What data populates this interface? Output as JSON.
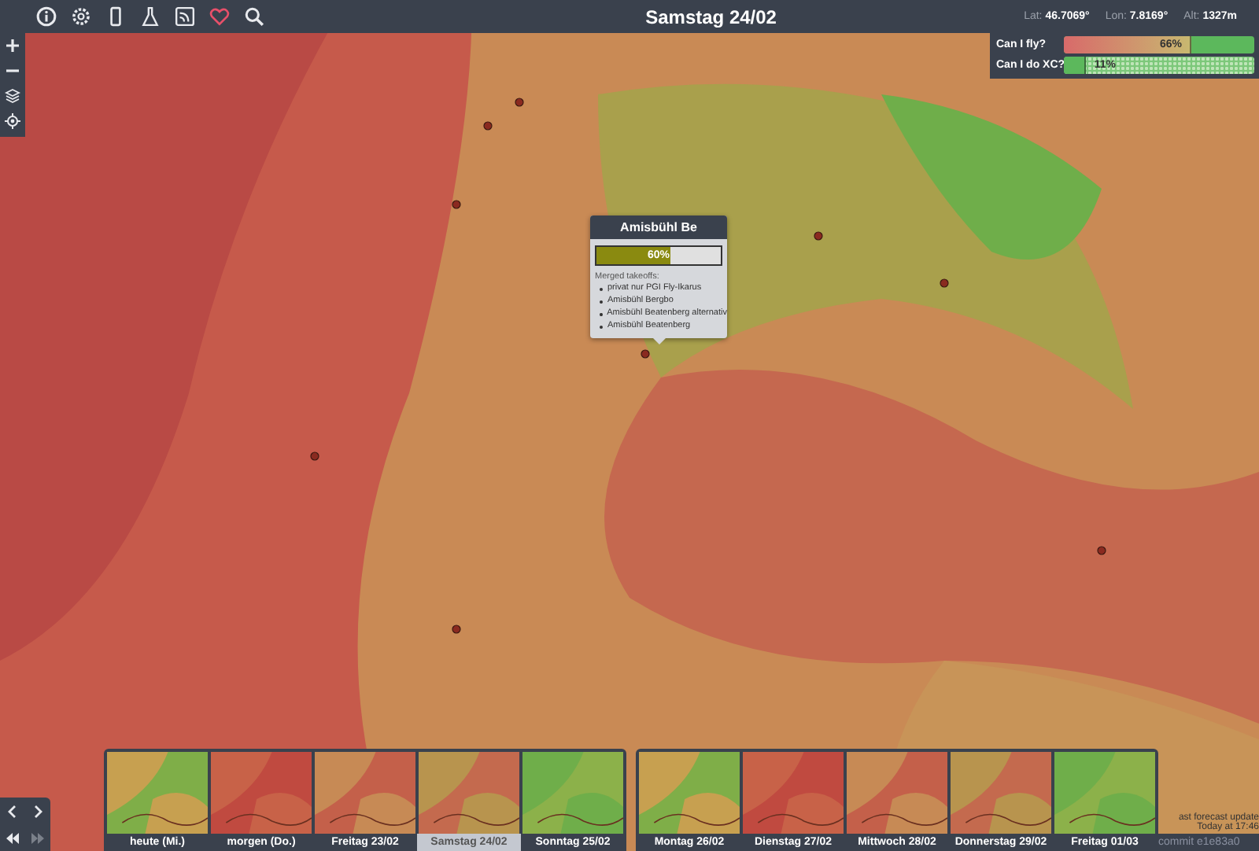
{
  "toolbar": {
    "title": "Samstag 24/02",
    "coords": [
      {
        "label": "Lat:",
        "value": "46.7069°"
      },
      {
        "label": "Lon:",
        "value": "7.8169°"
      },
      {
        "label": "Alt:",
        "value": "1327m"
      }
    ]
  },
  "gauges": [
    {
      "label": "Can I fly?",
      "reading": "66%",
      "level": 0.66,
      "kind": "gradient"
    },
    {
      "label": "Can I do XC?",
      "reading": "11%",
      "level": 0.11,
      "kind": "dotted"
    }
  ],
  "popup": {
    "title": "Amisbühl Be",
    "reading": "60%",
    "level": 0.6,
    "heading": "Merged takeoffs:",
    "items": [
      "privat nur PGI Fly-Ikarus",
      "Amisbühl Bergbo",
      "Amisbühl Beatenberg alternativ",
      "Amisbühl Beatenberg"
    ]
  },
  "days": [
    {
      "label": "heute (Mi.)",
      "selected": false
    },
    {
      "label": "morgen (Do.)",
      "selected": false
    },
    {
      "label": "Freitag 23/02",
      "selected": false
    },
    {
      "label": "Samstag 24/02",
      "selected": true
    },
    {
      "label": "Sonntag 25/02",
      "selected": false
    },
    {
      "label": "Montag 26/02",
      "selected": false
    },
    {
      "label": "Dienstag 27/02",
      "selected": false
    },
    {
      "label": "Mittwoch 28/02",
      "selected": false
    },
    {
      "label": "Donnerstag 29/02",
      "selected": false
    },
    {
      "label": "Freitag 01/03",
      "selected": false
    }
  ],
  "update": {
    "line_1": "ast forecast update",
    "line_2": "Today at 17:46"
  },
  "commit": "commit e1e83a0"
}
